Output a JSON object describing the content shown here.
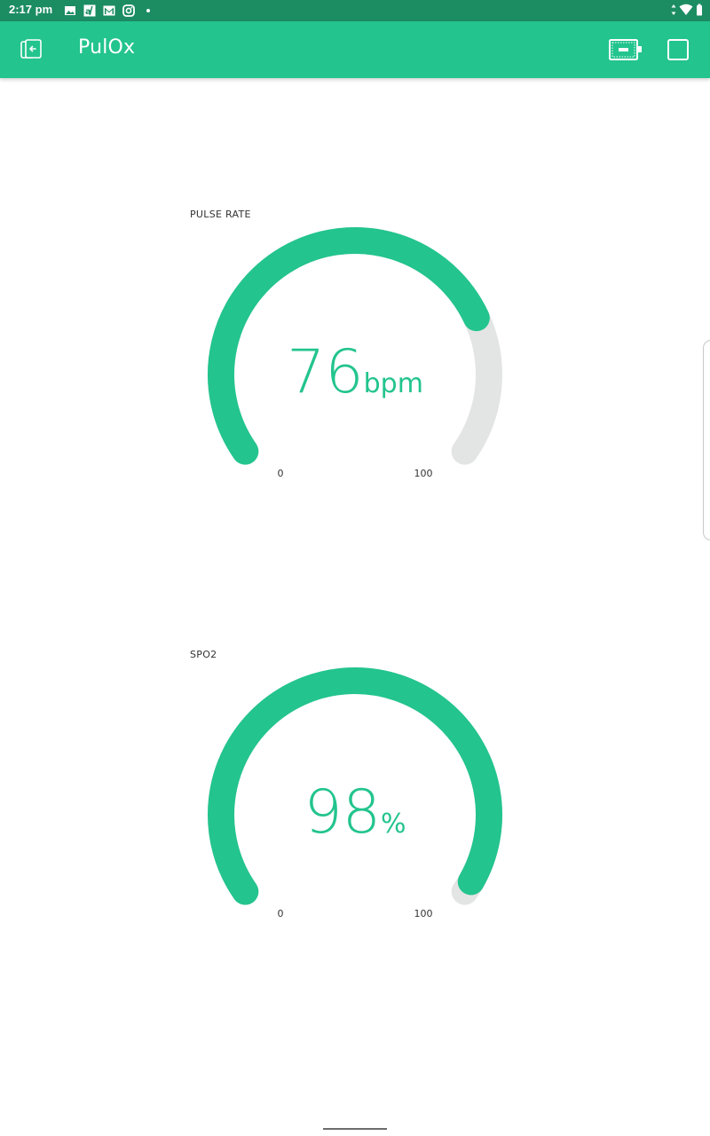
{
  "status_bar": {
    "time": "2:17 pm",
    "icons": [
      "image-icon",
      "app-icon",
      "gmail-icon",
      "instagram-icon",
      "dot-icon"
    ],
    "right_icons": [
      "data-arrows-icon",
      "wifi-icon",
      "battery-icon"
    ]
  },
  "app_bar": {
    "title": "PulOx",
    "color": "#23c48e",
    "left_icon": "exit-icon",
    "right_icons": [
      "device-icon",
      "square-icon"
    ]
  },
  "gauges": [
    {
      "label": "PULSE RATE",
      "value": "76",
      "unit": "bpm",
      "min": "0",
      "max": "100",
      "fraction": 0.76,
      "color": "#23c48e",
      "track_color": "#e3e4e4"
    },
    {
      "label": "SPO2",
      "value": "98",
      "unit": "%",
      "min": "0",
      "max": "100",
      "fraction": 0.98,
      "color": "#23c48e",
      "track_color": "#e3e4e4"
    }
  ]
}
